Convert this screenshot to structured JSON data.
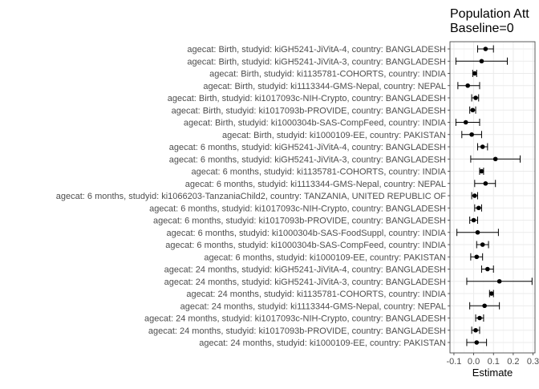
{
  "chart_data": {
    "type": "forest",
    "title": "Population Att",
    "subtitle": "Baseline=0",
    "xlabel": "Estimate",
    "ylabel": "",
    "xlim": [
      -0.12,
      0.31
    ],
    "xticks": [
      -0.1,
      0.0,
      0.1,
      0.2,
      0.3
    ],
    "xtick_labels": [
      "-0.1",
      "0.0",
      "0.1",
      "0.2",
      "0.3"
    ],
    "grid": true,
    "rows": [
      {
        "label": "agecat: Birth, studyid: kiGH5241-JiVitA-4, country: BANGLADESH",
        "estimate": 0.06,
        "lower": 0.02,
        "upper": 0.1
      },
      {
        "label": "agecat: Birth, studyid: kiGH5241-JiVitA-3, country: BANGLADESH",
        "estimate": 0.04,
        "lower": -0.09,
        "upper": 0.17
      },
      {
        "label": "agecat: Birth, studyid: ki1135781-COHORTS, country: INDIA",
        "estimate": 0.005,
        "lower": -0.005,
        "upper": 0.015
      },
      {
        "label": "agecat: Birth, studyid: ki1113344-GMS-Nepal, country: NEPAL",
        "estimate": -0.03,
        "lower": -0.08,
        "upper": 0.03
      },
      {
        "label": "agecat: Birth, studyid: ki1017093c-NIH-Crypto, country: BANGLADESH",
        "estimate": 0.01,
        "lower": -0.01,
        "upper": 0.025
      },
      {
        "label": "agecat: Birth, studyid: ki1017093b-PROVIDE, country: BANGLADESH",
        "estimate": -0.005,
        "lower": -0.02,
        "upper": 0.01
      },
      {
        "label": "agecat: Birth, studyid: ki1000304b-SAS-CompFeed, country: INDIA",
        "estimate": -0.04,
        "lower": -0.09,
        "upper": 0.03
      },
      {
        "label": "agecat: Birth, studyid: ki1000109-EE, country: PAKISTAN",
        "estimate": -0.01,
        "lower": -0.06,
        "upper": 0.04
      },
      {
        "label": "agecat: 6 months, studyid: kiGH5241-JiVitA-4, country: BANGLADESH",
        "estimate": 0.045,
        "lower": 0.02,
        "upper": 0.07
      },
      {
        "label": "agecat: 6 months, studyid: kiGH5241-JiVitA-3, country: BANGLADESH",
        "estimate": 0.11,
        "lower": -0.015,
        "upper": 0.235
      },
      {
        "label": "agecat: 6 months, studyid: ki1135781-COHORTS, country: INDIA",
        "estimate": 0.04,
        "lower": 0.03,
        "upper": 0.05
      },
      {
        "label": "agecat: 6 months, studyid: ki1113344-GMS-Nepal, country: NEPAL",
        "estimate": 0.06,
        "lower": 0.005,
        "upper": 0.11
      },
      {
        "label": "agecat: 6 months, studyid: ki1066203-TanzaniaChild2, country: TANZANIA, UNITED REPUBLIC OF",
        "estimate": 0.005,
        "lower": -0.01,
        "upper": 0.02
      },
      {
        "label": "agecat: 6 months, studyid: ki1017093c-NIH-Crypto, country: BANGLADESH",
        "estimate": 0.025,
        "lower": 0.005,
        "upper": 0.04
      },
      {
        "label": "agecat: 6 months, studyid: ki1017093b-PROVIDE, country: BANGLADESH",
        "estimate": 0.0,
        "lower": -0.02,
        "upper": 0.02
      },
      {
        "label": "agecat: 6 months, studyid: ki1000304b-SAS-FoodSuppl, country: INDIA",
        "estimate": 0.02,
        "lower": -0.085,
        "upper": 0.125
      },
      {
        "label": "agecat: 6 months, studyid: ki1000304b-SAS-CompFeed, country: INDIA",
        "estimate": 0.045,
        "lower": 0.015,
        "upper": 0.075
      },
      {
        "label": "agecat: 6 months, studyid: ki1000109-EE, country: PAKISTAN",
        "estimate": 0.015,
        "lower": -0.015,
        "upper": 0.045
      },
      {
        "label": "agecat: 24 months, studyid: kiGH5241-JiVitA-4, country: BANGLADESH",
        "estimate": 0.07,
        "lower": 0.04,
        "upper": 0.1
      },
      {
        "label": "agecat: 24 months, studyid: kiGH5241-JiVitA-3, country: BANGLADESH",
        "estimate": 0.13,
        "lower": -0.035,
        "upper": 0.295
      },
      {
        "label": "agecat: 24 months, studyid: ki1135781-COHORTS, country: INDIA",
        "estimate": 0.09,
        "lower": 0.08,
        "upper": 0.1
      },
      {
        "label": "agecat: 24 months, studyid: ki1113344-GMS-Nepal, country: NEPAL",
        "estimate": 0.055,
        "lower": -0.02,
        "upper": 0.13
      },
      {
        "label": "agecat: 24 months, studyid: ki1017093c-NIH-Crypto, country: BANGLADESH",
        "estimate": 0.03,
        "lower": 0.01,
        "upper": 0.05
      },
      {
        "label": "agecat: 24 months, studyid: ki1017093b-PROVIDE, country: BANGLADESH",
        "estimate": 0.01,
        "lower": -0.01,
        "upper": 0.03
      },
      {
        "label": "agecat: 24 months, studyid: ki1000109-EE, country: PAKISTAN",
        "estimate": 0.015,
        "lower": -0.035,
        "upper": 0.065
      }
    ]
  }
}
